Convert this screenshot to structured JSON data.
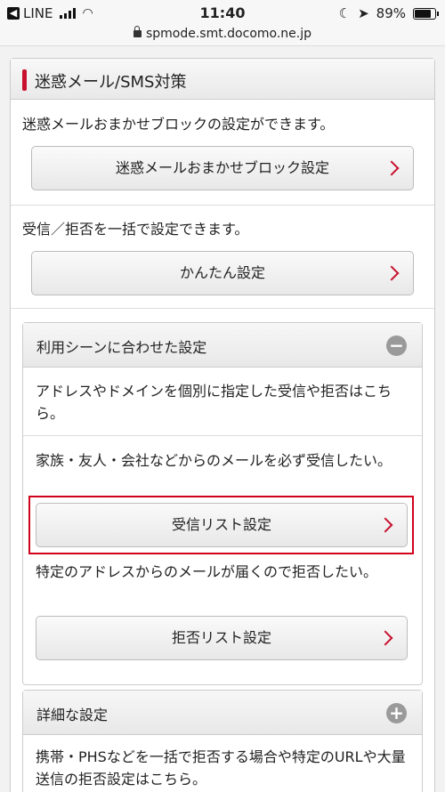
{
  "status": {
    "app": "LINE",
    "time": "11:40",
    "battery": "89%",
    "battery_level": 0.89
  },
  "url": "spmode.smt.docomo.ne.jp",
  "section": {
    "title": "迷惑メール/SMS対策",
    "desc1": "迷惑メールおまかせブロックの設定ができます。",
    "btn1": "迷惑メールおまかせブロック設定",
    "desc2": "受信／拒否を一括で設定できます。",
    "btn2": "かんたん設定"
  },
  "scene": {
    "title": "利用シーンに合わせた設定",
    "toggle": "−",
    "desc1": "アドレスやドメインを個別に指定した受信や拒否はこちら。",
    "desc2": "家族・友人・会社などからのメールを必ず受信したい。",
    "btn_receive": "受信リスト設定",
    "desc3": "特定のアドレスからのメールが届くので拒否したい。",
    "btn_reject": "拒否リスト設定"
  },
  "detail": {
    "title": "詳細な設定",
    "toggle": "+",
    "desc": "携帯・PHSなどを一括で拒否する場合や特定のURLや大量送信の拒否設定はこちら。"
  }
}
